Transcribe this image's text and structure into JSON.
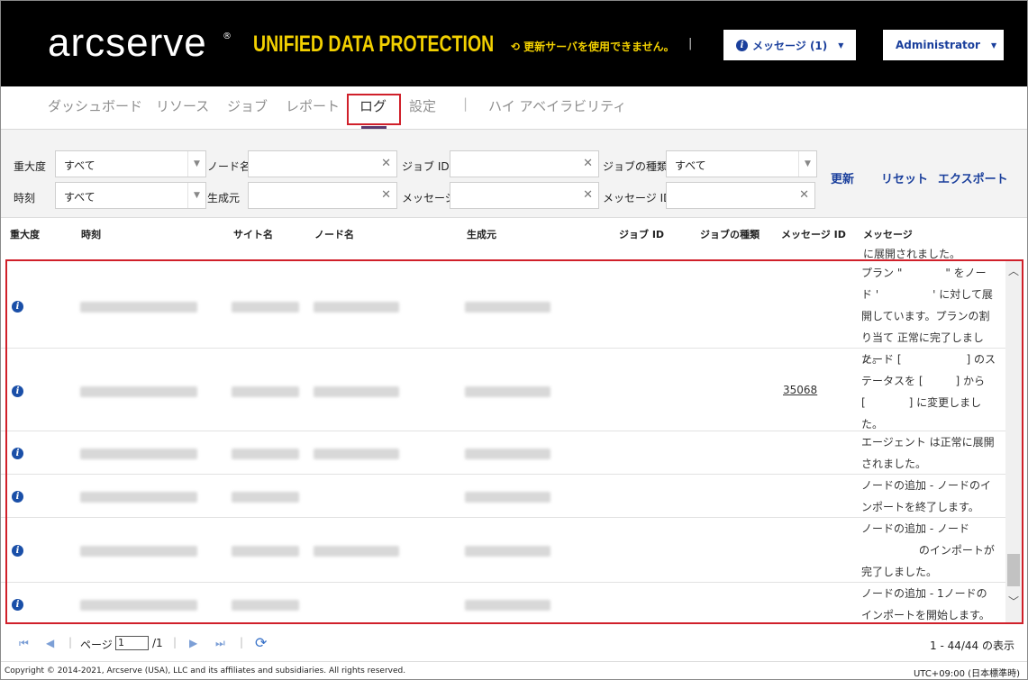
{
  "header": {
    "brand": "arcserve",
    "brand_mark": "®",
    "product": "UNIFIED DATA PROTECTION",
    "update_status": "更新サーバを使用できません。",
    "messages_button": "メッセージ (1)",
    "user_button": "Administrator"
  },
  "nav": {
    "items": [
      "ダッシュボード",
      "リソース",
      "ジョブ",
      "レポート",
      "ログ",
      "設定",
      "ハイ アベイラビリティ"
    ],
    "active": "ログ"
  },
  "filters": {
    "severity_label": "重大度",
    "severity_value": "すべて",
    "time_label": "時刻",
    "time_value": "すべて",
    "node_label": "ノード名",
    "node_value": "",
    "source_label": "生成元",
    "source_value": "",
    "jobid_label": "ジョブ ID",
    "jobid_value": "",
    "message_label": "メッセージ",
    "message_value": "",
    "jobtype_label": "ジョブの種類",
    "jobtype_value": "すべて",
    "msgid_label": "メッセージ ID",
    "msgid_value": "",
    "refresh": "更新",
    "reset": "リセット",
    "export": "エクスポート"
  },
  "table": {
    "columns": [
      "重大度",
      "時刻",
      "サイト名",
      "ノード名",
      "生成元",
      "ジョブ ID",
      "ジョブの種類",
      "メッセージ ID",
      "メッセージ"
    ],
    "partial_top_message": "に展開されました。",
    "rows": [
      {
        "severity": "info",
        "message_id": "",
        "message": "プラン \"　　　　\" をノード '　　　　　' に対して展開しています。プランの割り当て 正常に完了しました。"
      },
      {
        "severity": "info",
        "message_id": "35068",
        "message": "ノード [　　　　　　] のステータスを [　　　] から [　　　　] に変更しました。"
      },
      {
        "severity": "info",
        "message_id": "",
        "message": "エージェント は正常に展開されました。"
      },
      {
        "severity": "info",
        "message_id": "",
        "message": "ノードの追加 - ノードのインポートを終了します。"
      },
      {
        "severity": "info",
        "message_id": "",
        "message": "ノードの追加 - ノード 　　　　　 のインポートが完了しました。"
      },
      {
        "severity": "info",
        "message_id": "",
        "message": "ノードの追加 - 1ノードのインポートを開始します。"
      }
    ]
  },
  "pager": {
    "page_label": "ページ",
    "page_value": "1",
    "total_pages": "/1",
    "count": "1 - 44/44 の表示"
  },
  "footer": {
    "copyright": "Copyright © 2014-2021, Arcserve (USA), LLC and its affiliates and subsidiaries. All rights reserved.",
    "timezone": "UTC+09:00 (日本標準時)"
  },
  "colors": {
    "header_bg": "#000000",
    "product_yellow": "#f2d000",
    "link_blue": "#1a3f9c",
    "highlight_red": "#d0202a"
  }
}
